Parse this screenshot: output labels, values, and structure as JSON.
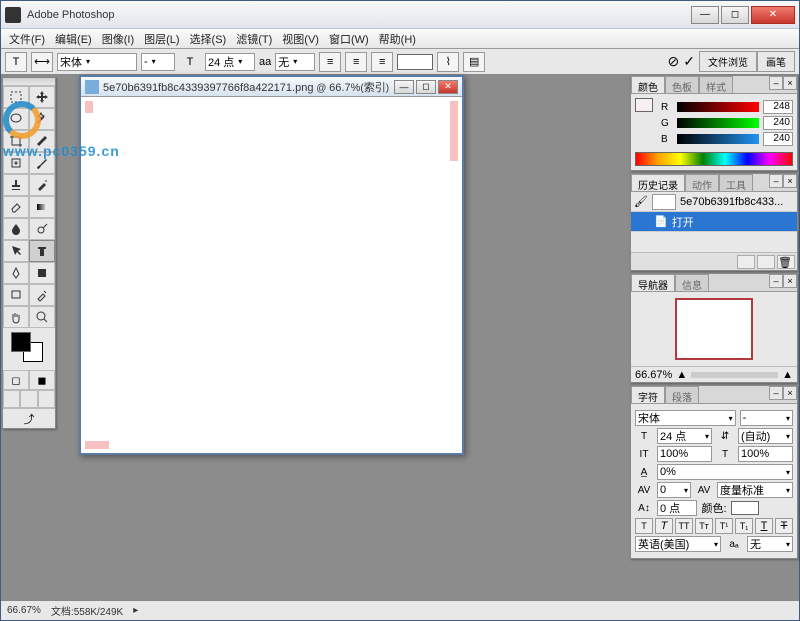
{
  "window": {
    "title": "Adobe Photoshop"
  },
  "menu": {
    "file": "文件(F)",
    "edit": "编辑(E)",
    "image": "图像(I)",
    "layer": "图层(L)",
    "select": "选择(S)",
    "filter": "滤镜(T)",
    "view": "视图(V)",
    "window": "窗口(W)",
    "help": "帮助(H)"
  },
  "options": {
    "font_family": "宋体",
    "font_style": "-",
    "font_size": "24 点",
    "aa_label": "aa",
    "aa_value": "无",
    "color_hex": "#ffffff"
  },
  "doc": {
    "filename": "5e70b6391fb8c4339397766f8a422171.png",
    "zoom_pct": "66.7%",
    "mode": "索引"
  },
  "tabs_right": {
    "browse": "文件浏览",
    "brushes": "画笔"
  },
  "color_panel": {
    "tab_color": "颜色",
    "tab_swatch": "色板",
    "tab_styles": "样式",
    "r": 248,
    "g": 240,
    "b": 240
  },
  "history_panel": {
    "tab_history": "历史记录",
    "tab_actions": "动作",
    "tab_tools": "工具",
    "snapshot": "5e70b6391fb8c433...",
    "step_open": "打开"
  },
  "navigator_panel": {
    "tab_nav": "导航器",
    "tab_info": "信息",
    "zoom": "66.67%"
  },
  "character_panel": {
    "tab_char": "字符",
    "tab_para": "段落",
    "font": "宋体",
    "size": "24 点",
    "leading": "(自动)",
    "tracking_h": "100%",
    "tracking_v": "100%",
    "kerning": "0%",
    "metrics": "度量标准",
    "baseline": "0 点",
    "color_label": "颜色:",
    "lang": "英语(美国)",
    "aa_val": "无"
  },
  "status": {
    "zoom": "66.67%",
    "docinfo": "文档:558K/249K"
  },
  "watermark": {
    "url": "www.pc0359.cn"
  },
  "icons": {
    "min": "—",
    "max": "◻",
    "close": "✕",
    "check": "✓",
    "cancel": "⊘",
    "tri": "▾",
    "play": "▸"
  }
}
